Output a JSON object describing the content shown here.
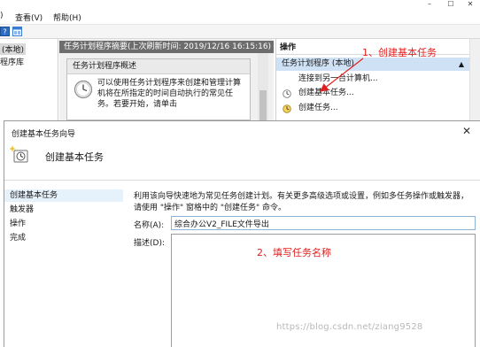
{
  "menu": {
    "file_partial": ")",
    "view": "查看(V)",
    "help": "帮助(H)"
  },
  "tree": {
    "local": "(本地)",
    "library": "程序库"
  },
  "center": {
    "summary": "任务计划程序摘要(上次刷新时间: 2019/12/16 16:15:16)",
    "overview_title": "任务计划程序概述",
    "overview_text": "可以使用任务计划程序来创建和管理计算机将在所指定的时间自动执行的常见任务。若要开始，请单击"
  },
  "actions": {
    "header": "操作",
    "group": "任务计划程序 (本地)",
    "items": [
      "连接到另一台计算机...",
      "创建基本任务...",
      "创建任务..."
    ]
  },
  "annotations": {
    "step1": "1、创建基本任务",
    "step2": "2、填写任务名称"
  },
  "wizard": {
    "title": "创建基本任务向导",
    "close": "✕",
    "header": "创建基本任务",
    "steps": [
      "创建基本任务",
      "触发器",
      "操作",
      "完成"
    ],
    "description": "利用该向导快速地为常见任务创建计划。有关更多高级选项或设置，例如多任务操作或触发器，请使用 \"操作\" 窗格中的 \"创建任务\" 命令。",
    "name_label": "名称(A):",
    "name_value": "综合办公V2_FILE文件导出",
    "desc_label": "描述(D):",
    "desc_value": ""
  },
  "watermark": "https://blog.csdn.net/ziang9528",
  "colors": {
    "annotation": "#e0201f",
    "summary_bar": "#6d6d6d",
    "actions_group": "#cfe2f5",
    "active_step": "#e5f1fb"
  },
  "icons": {
    "toolbar": [
      "help-icon",
      "panel-icon"
    ],
    "overview": "clock-icon",
    "connect": "computer-icon",
    "basic_task": "basic-task-icon",
    "task": "task-icon",
    "wizard": "wizard-task-icon"
  }
}
